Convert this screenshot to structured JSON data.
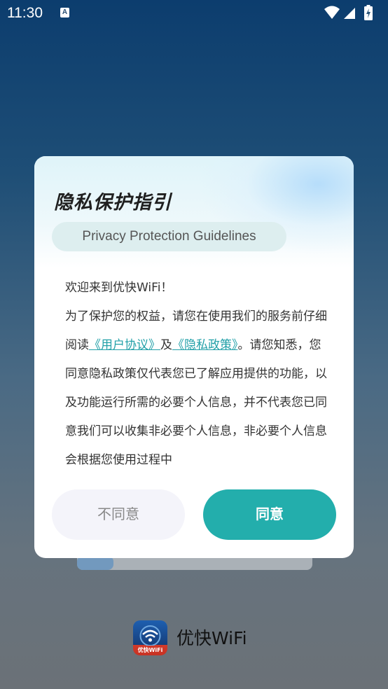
{
  "status_bar": {
    "time": "11:30",
    "notification_icon_letter": "A",
    "icons": [
      "wifi-icon",
      "signal-icon",
      "battery-charging-icon"
    ]
  },
  "dialog": {
    "title": "隐私保护指引",
    "subtitle": "Privacy Protection Guidelines",
    "body": {
      "greeting": "欢迎来到优快WiFi！",
      "intro_before_links": "为了保护您的权益，请您在使用我们的服务前仔细阅读",
      "user_agreement_link": "《用户协议》",
      "connector": "及",
      "privacy_policy_link": "《隐私政策》",
      "after_links": "。请您知悉，您同意隐私政策仅代表您已了解应用提供的功能，以及功能运行所需的必要个人信息，并不代表您已同意我们可以收集非必要个人信息，非必要个人信息会根据您使用过程中"
    },
    "disagree_label": "不同意",
    "agree_label": "同意"
  },
  "brand": {
    "app_name": "优快WiFi",
    "icon_label": "优快WiFi"
  },
  "colors": {
    "accent": "#23aeac",
    "link": "#22a0a8",
    "background_top": "#0c3d6e",
    "background_bottom": "#6b7177"
  }
}
